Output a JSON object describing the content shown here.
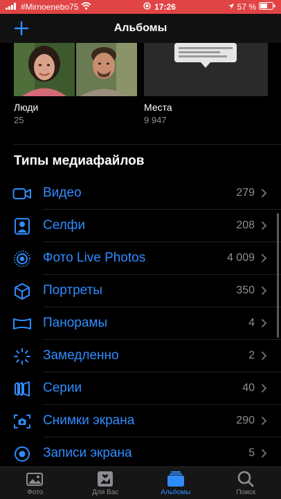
{
  "status_bar": {
    "carrier": "#Mirnoenebo75",
    "time": "17:26",
    "battery": "57 %",
    "bg_color": "#e04444"
  },
  "nav": {
    "title": "Альбомы",
    "add_icon": "plus-icon"
  },
  "albums": [
    {
      "label": "Люди",
      "count": "25"
    },
    {
      "label": "Места",
      "count": "9 947"
    }
  ],
  "media_types": {
    "title": "Типы медиафайлов",
    "items": [
      {
        "label": "Видео",
        "count": "279",
        "icon": "video-icon"
      },
      {
        "label": "Селфи",
        "count": "208",
        "icon": "selfie-icon"
      },
      {
        "label": "Фото Live Photos",
        "count": "4 009",
        "icon": "live-photo-icon"
      },
      {
        "label": "Портреты",
        "count": "350",
        "icon": "portrait-cube-icon"
      },
      {
        "label": "Панорамы",
        "count": "4",
        "icon": "panorama-icon"
      },
      {
        "label": "Замедленно",
        "count": "2",
        "icon": "slo-mo-icon"
      },
      {
        "label": "Серии",
        "count": "40",
        "icon": "burst-icon"
      },
      {
        "label": "Снимки экрана",
        "count": "290",
        "icon": "screenshot-icon"
      },
      {
        "label": "Записи экрана",
        "count": "5",
        "icon": "screen-recording-icon"
      }
    ]
  },
  "tabs": [
    {
      "label": "Фото",
      "icon": "photo-icon",
      "active": false
    },
    {
      "label": "Для Вас",
      "icon": "for-you-icon",
      "active": false
    },
    {
      "label": "Альбомы",
      "icon": "albums-icon",
      "active": true
    },
    {
      "label": "Поиск",
      "icon": "search-icon",
      "active": false
    }
  ],
  "colors": {
    "accent": "#2f8cff",
    "secondary_text": "#8e8e93",
    "background": "#000000"
  }
}
